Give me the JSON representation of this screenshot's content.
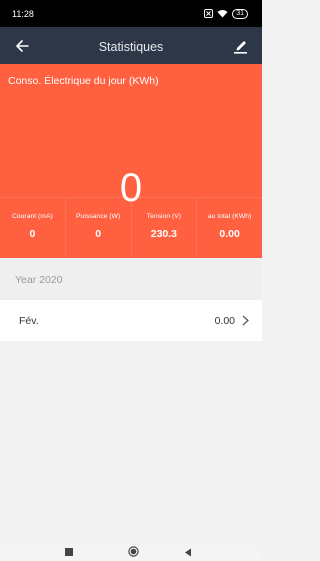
{
  "status_bar": {
    "time": "11:28",
    "battery": "31"
  },
  "app_bar": {
    "title": "Statistiques"
  },
  "hero": {
    "label": "Conso. Électrique du jour (KWh)",
    "value": "0"
  },
  "stats": [
    {
      "label": "Courant (mA)",
      "value": "0"
    },
    {
      "label": "Puissance (W)",
      "value": "0"
    },
    {
      "label": "Tension (V)",
      "value": "230.3"
    },
    {
      "label": "au total (KWh)",
      "value": "0.00"
    }
  ],
  "history": {
    "year_label": "Year 2020",
    "months": [
      {
        "name": "Fév.",
        "value": "0.00"
      }
    ]
  },
  "colors": {
    "accent": "#fe6040",
    "toolbar": "#2e3748"
  },
  "icons": [
    "back-arrow-icon",
    "edit-icon",
    "chevron-right-icon",
    "wifi-icon",
    "battery-icon",
    "nav-square-icon",
    "nav-circle-icon",
    "nav-back-triangle-icon"
  ]
}
